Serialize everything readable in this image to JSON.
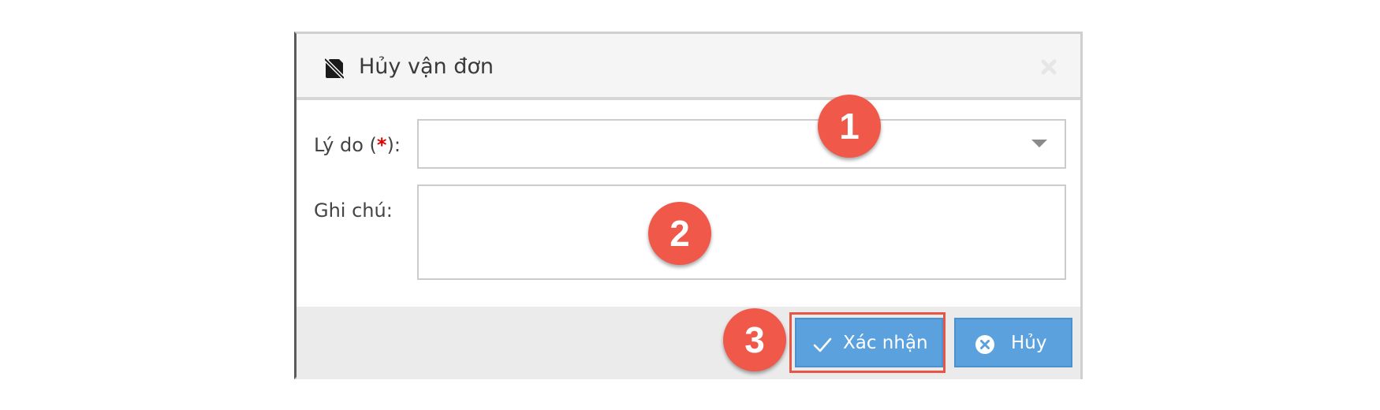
{
  "dialog": {
    "title": "Hủy vận đơn",
    "header_icon": "no-sim-card-icon",
    "close_icon": "close-icon"
  },
  "form": {
    "reason": {
      "label_prefix": "Lý do (",
      "required_mark": "*",
      "label_suffix": "):",
      "value": ""
    },
    "note": {
      "label": "Ghi chú:",
      "value": ""
    }
  },
  "footer": {
    "confirm_label": "Xác nhận",
    "confirm_icon": "checkmark-icon",
    "cancel_label": "Hủy",
    "cancel_icon": "x-circle-icon"
  },
  "annotations": {
    "step1": "1",
    "step2": "2",
    "step3": "3"
  },
  "colors": {
    "button_blue": "#5aa1dd",
    "badge_red": "#f0584a",
    "highlight_red": "#e85545",
    "required_red": "#e00000"
  }
}
